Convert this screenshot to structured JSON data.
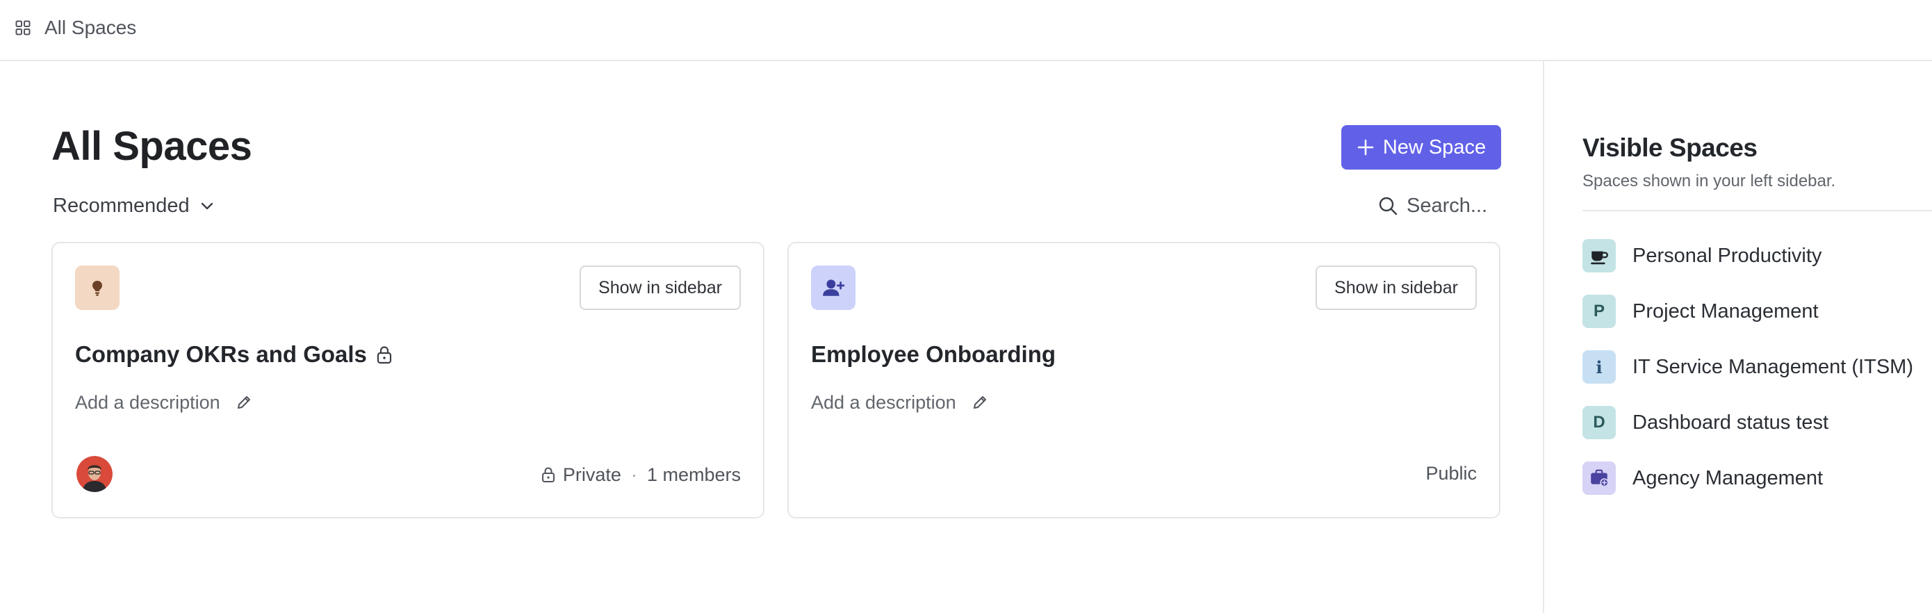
{
  "topbar": {
    "title": "All Spaces",
    "icon": "grid-icon"
  },
  "header": {
    "title": "All Spaces",
    "new_space_label": "New Space",
    "sort_label": "Recommended",
    "search_placeholder": "Search..."
  },
  "cards": [
    {
      "title": "Company OKRs and Goals",
      "icon": "lightbulb-icon",
      "icon_bg": "#f3d8c3",
      "icon_color": "#6b4227",
      "show_in_sidebar_label": "Show in sidebar",
      "description_placeholder": "Add a description",
      "visibility": "Private",
      "members": "1 members"
    },
    {
      "title": "Employee Onboarding",
      "icon": "user-plus-icon",
      "icon_bg": "#cdd2fb",
      "icon_color": "#3a3f9e",
      "show_in_sidebar_label": "Show in sidebar",
      "description_placeholder": "Add a description",
      "visibility": "Public"
    }
  ],
  "sidebar": {
    "title": "Visible Spaces",
    "subtitle": "Spaces shown in your left sidebar.",
    "items": [
      {
        "label": "Personal Productivity",
        "icon": "coffee-cup-icon",
        "badge_text": "",
        "bg": "#c4e3e4",
        "color": "#1f2328"
      },
      {
        "label": "Project Management",
        "icon": "letter-badge",
        "badge_text": "P",
        "bg": "#c4e3e4",
        "color": "#2c5a5c"
      },
      {
        "label": "IT Service Management (ITSM)",
        "icon": "info-icon",
        "badge_text": "i",
        "bg": "#c6dff3",
        "color": "#2b5276"
      },
      {
        "label": "Dashboard status test",
        "icon": "letter-badge",
        "badge_text": "D",
        "bg": "#c4e3e4",
        "color": "#2c5a5c"
      },
      {
        "label": "Agency Management",
        "icon": "briefcase-icon",
        "badge_text": "",
        "bg": "#d7d3f6",
        "color": "#4a42a0"
      }
    ]
  }
}
